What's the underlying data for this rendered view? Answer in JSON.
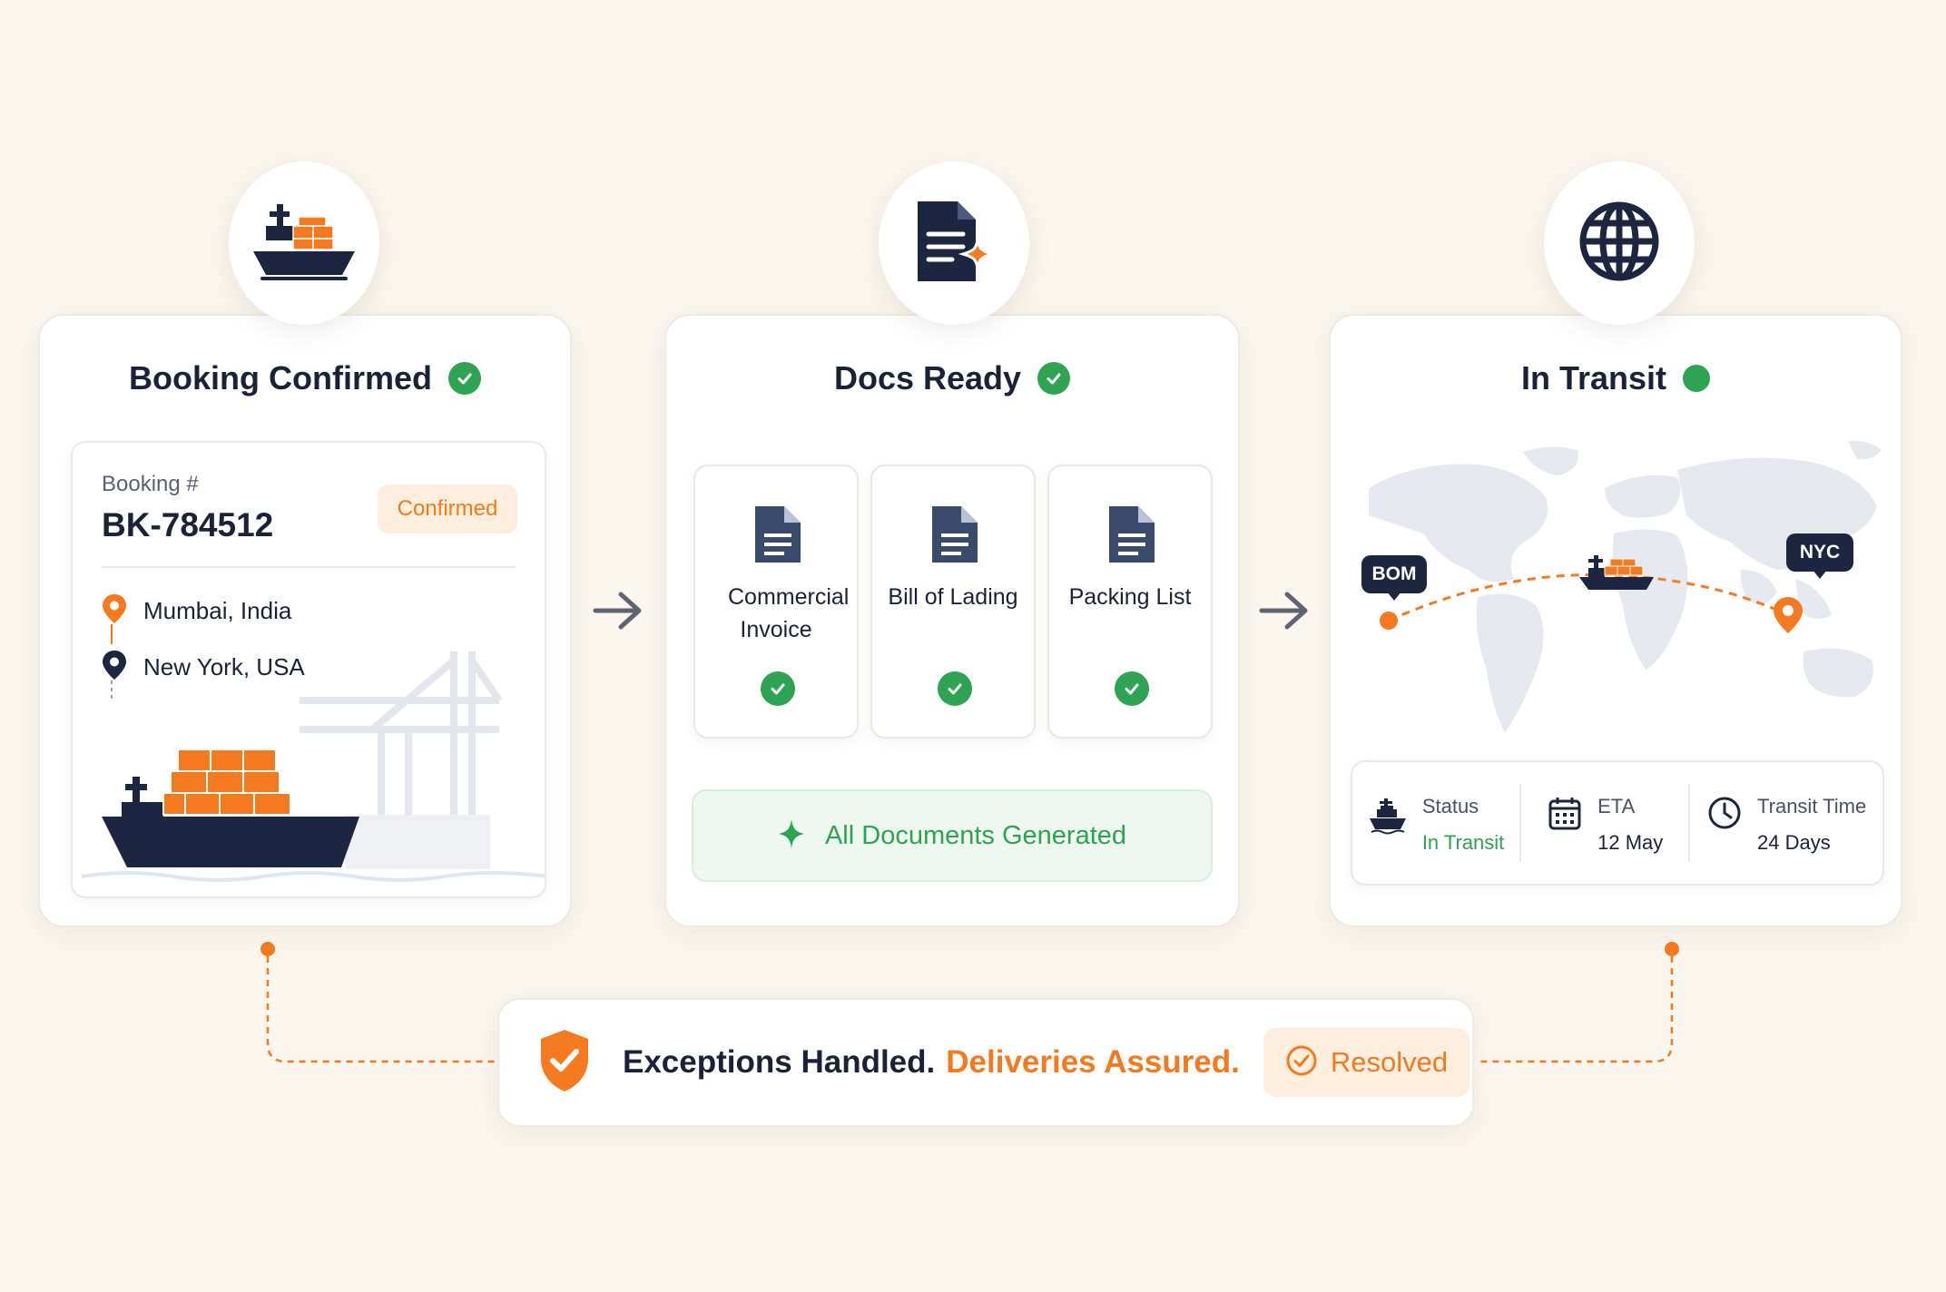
{
  "colors": {
    "background": "#fbf6ee",
    "navy": "#1c2640",
    "orange": "#f57a1f",
    "green": "#2ea352",
    "resolved_bg": "#fdeedd"
  },
  "stages": {
    "booking": {
      "icon": "cargo-ship-icon",
      "title": "Booking Confirmed",
      "booking_label": "Booking #",
      "booking_number": "BK-784512",
      "status_badge": "Confirmed",
      "origin": "Mumbai, India",
      "destination": "New York, USA"
    },
    "docs": {
      "icon": "document-sparkle-icon",
      "title": "Docs Ready",
      "documents": [
        {
          "label": "Commercial Invoice",
          "icon": "document-icon",
          "status": "complete"
        },
        {
          "label": "Bill of Lading",
          "icon": "document-icon",
          "status": "complete"
        },
        {
          "label": "Packing List",
          "icon": "document-icon",
          "status": "complete"
        }
      ],
      "banner": "All Documents Generated"
    },
    "transit": {
      "icon": "globe-icon",
      "title": "In Transit",
      "origin_code": "BOM",
      "destination_code": "NYC",
      "stats": [
        {
          "label": "Status",
          "value": "In Transit",
          "icon": "ship-icon"
        },
        {
          "label": "ETA",
          "value": "12 May",
          "icon": "calendar-icon"
        },
        {
          "label": "Transit Time",
          "value": "24 Days",
          "icon": "clock-icon"
        }
      ]
    }
  },
  "footer": {
    "text_primary": "Exceptions Handled.",
    "text_accent": "Deliveries Assured.",
    "resolved_label": "Resolved",
    "icon": "shield-check-icon"
  }
}
